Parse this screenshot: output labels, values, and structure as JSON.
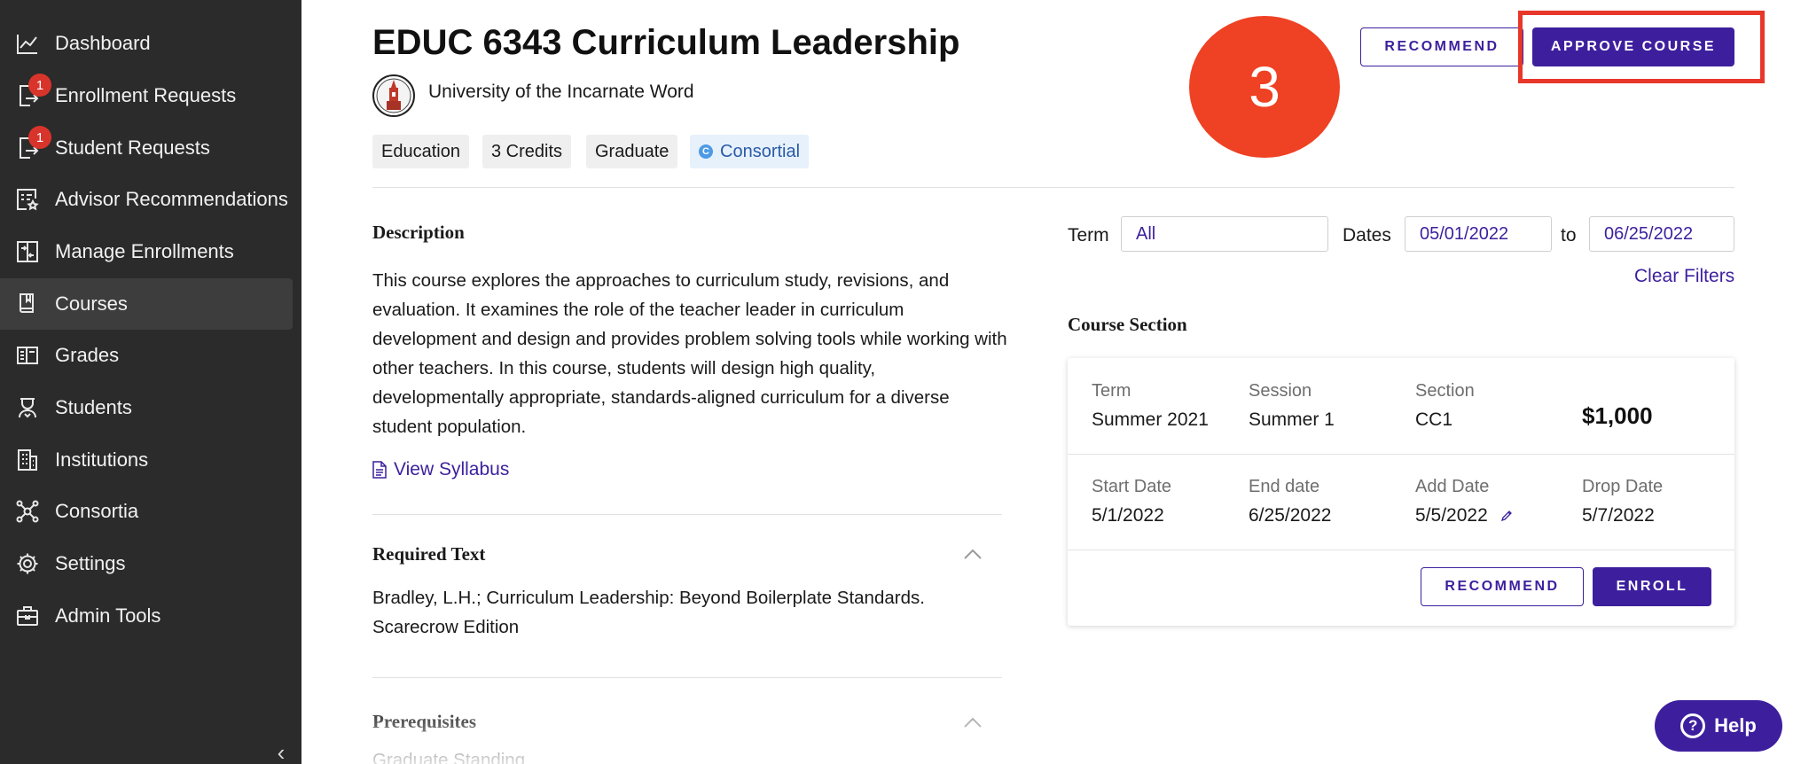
{
  "sidebar": {
    "items": [
      {
        "label": "Dashboard",
        "icon": "chart-line-icon",
        "badge": ""
      },
      {
        "label": "Enrollment Requests",
        "icon": "file-export-icon",
        "badge": "1"
      },
      {
        "label": "Student Requests",
        "icon": "file-export-icon",
        "badge": "1"
      },
      {
        "label": "Advisor Recommendations",
        "icon": "list-star-icon",
        "badge": ""
      },
      {
        "label": "Manage Enrollments",
        "icon": "file-swap-icon",
        "badge": ""
      },
      {
        "label": "Courses",
        "icon": "book-icon",
        "badge": ""
      },
      {
        "label": "Grades",
        "icon": "gradebook-icon",
        "badge": ""
      },
      {
        "label": "Students",
        "icon": "student-icon",
        "badge": ""
      },
      {
        "label": "Institutions",
        "icon": "building-icon",
        "badge": ""
      },
      {
        "label": "Consortia",
        "icon": "network-icon",
        "badge": ""
      },
      {
        "label": "Settings",
        "icon": "gear-icon",
        "badge": ""
      },
      {
        "label": "Admin Tools",
        "icon": "toolbox-icon",
        "badge": ""
      }
    ],
    "active": "Courses",
    "collapse_glyph": "‹"
  },
  "header": {
    "title": "EDUC 6343 Curriculum Leadership",
    "institution": "University of the Incarnate Word",
    "tags": [
      "Education",
      "3 Credits",
      "Graduate",
      "Consortial"
    ],
    "consortial_glyph": "C",
    "step_number": "3",
    "recommend_label": "RECOMMEND",
    "approve_label": "APPROVE COURSE"
  },
  "description": {
    "heading": "Description",
    "text": "This course explores the approaches to curriculum study, revisions, and evaluation. It examines the role of the teacher leader in curriculum development and design and provides problem solving tools while working with other teachers. In this course, students will design high quality, developmentally appropriate, standards-aligned curriculum for a diverse student population.",
    "syllabus_link": "View Syllabus"
  },
  "required_text": {
    "heading": "Required Text",
    "text": "Bradley, L.H.; Curriculum Leadership: Beyond Boilerplate Standards. Scarecrow Edition"
  },
  "prerequisites": {
    "heading": "Prerequisites",
    "text": "Graduate Standing"
  },
  "filters": {
    "term_label": "Term",
    "term_value": "All",
    "dates_label": "Dates",
    "date_from": "05/01/2022",
    "to_label": "to",
    "date_to": "06/25/2022",
    "clear_label": "Clear Filters"
  },
  "course_section": {
    "heading": "Course Section",
    "term_label": "Term",
    "term": "Summer 2021",
    "session_label": "Session",
    "session": "Summer 1",
    "section_label": "Section",
    "section": "CC1",
    "price": "$1,000",
    "start_label": "Start Date",
    "start": "5/1/2022",
    "end_label": "End date",
    "end": "6/25/2022",
    "add_label": "Add Date",
    "add": "5/5/2022",
    "drop_label": "Drop Date",
    "drop": "5/7/2022",
    "recommend_label": "RECOMMEND",
    "enroll_label": "ENROLL"
  },
  "help": {
    "label": "Help",
    "glyph": "?"
  },
  "colors": {
    "sidebar_bg": "#2b2b2b",
    "accent": "#3d1f9e",
    "badge": "#d9342b",
    "step_circle": "#ef4123",
    "highlight": "#e8372a"
  }
}
